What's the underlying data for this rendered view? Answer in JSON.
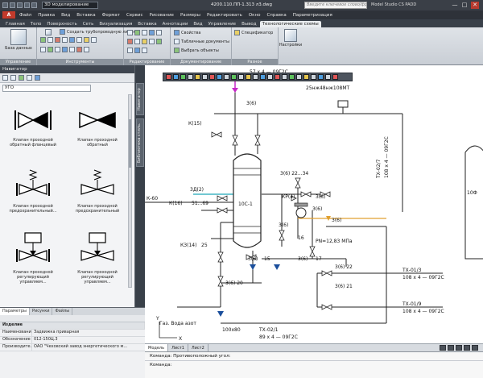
{
  "titlebar": {
    "workspace": "3D моделирование",
    "doc_title": "4200.110.ПП-1.313 л3.dwg",
    "search_placeholder": "Введите ключевое слово/фразу",
    "app_name": "Model Studio CS PADD",
    "min_glyph": "—",
    "max_glyph": "□",
    "close_glyph": "✕"
  },
  "menubar": {
    "app_button": "A",
    "items": [
      "Файл",
      "Правка",
      "Вид",
      "Вставка",
      "Формат",
      "Сервис",
      "Рисование",
      "Размеры",
      "Редактировать",
      "Окно",
      "Справка",
      "Параметризация"
    ]
  },
  "ribbon_tabs": [
    "Главная",
    "Тело",
    "Поверхность",
    "Сеть",
    "Визуализация",
    "Вставка",
    "Аннотации",
    "Вид",
    "Управление",
    "Вывод",
    "Технологические схемы"
  ],
  "ribbon_active_tab": "Технологические схемы",
  "ribbon": {
    "manage_title": "Управление",
    "database_label": "База данных",
    "tools_title": "Инструменты",
    "tools_row1": "Создать трубопроводную линию",
    "edit_title": "Редактирование",
    "docs_title": "Документирование",
    "docs_items": [
      "Свойства",
      "Табличные документы",
      "Выбрать объекты"
    ],
    "spec_label": "Спецификатор",
    "misc_title": "Разное",
    "settings_label": "Настройки"
  },
  "nav": {
    "header": "Навигатор",
    "search_value": "УГО",
    "items": [
      {
        "label": "Клапан проходной обратный фланцевый"
      },
      {
        "label": "Клапан проходной обратный"
      },
      {
        "label": "Клапан проходной предохранительный..."
      },
      {
        "label": "Клапан проходной предохранительный"
      },
      {
        "label": "Клапан проходной регулирующий управляем..."
      },
      {
        "label": "Клапан проходной регулирующий управляем..."
      }
    ]
  },
  "vtabs": [
    "Навигатор",
    "Библиотека стиль."
  ],
  "props": {
    "tabs": [
      "Параметры",
      "Рисунки",
      "Файлы"
    ],
    "group": "Изделие",
    "rows": [
      {
        "key": "Наименование",
        "value": "Задвижка приварная"
      },
      {
        "key": "Обозначение",
        "value": "012-150Ц.3"
      },
      {
        "key": "Производите...",
        "value": "ОАО \"Чеховский завод энергетического м..."
      }
    ]
  },
  "drawing": {
    "labels": [
      {
        "text": "57 х 4 — 09Г2С"
      },
      {
        "text": "25нж48нж108МТ"
      },
      {
        "text": "К(15)"
      },
      {
        "text": "3(6)"
      },
      {
        "text": "3Д(2)"
      },
      {
        "text": "К(16)"
      },
      {
        "text": "51...69"
      },
      {
        "text": "3(6) 22...34"
      },
      {
        "text": "КР(4)"
      },
      {
        "text": "3(6)"
      },
      {
        "text": "3(6)"
      },
      {
        "text": "10С-1"
      },
      {
        "text": "3(6)"
      },
      {
        "text": "PN=12,83 МПа"
      },
      {
        "text": "КЗ(14)"
      },
      {
        "text": "25"
      },
      {
        "text": "16"
      },
      {
        "text": "3(6)"
      },
      {
        "text": "3(6)"
      },
      {
        "text": "15"
      },
      {
        "text": "3(6)"
      },
      {
        "text": "17"
      },
      {
        "text": "3(6) 22"
      },
      {
        "text": "3(6) 20"
      },
      {
        "text": "3(6) 21"
      },
      {
        "text": "ТХ-01/3"
      },
      {
        "text": "108 х 4 — 09Г2С"
      },
      {
        "text": "ТХ-01/9"
      },
      {
        "text": "108 х 4 — 09Г2С"
      },
      {
        "text": "Газ. Вода  азот"
      },
      {
        "text": "100х80"
      },
      {
        "text": "ТХ-02/1"
      },
      {
        "text": "89 х 4 — 09Г2С"
      },
      {
        "text": "ТХ-02/7"
      },
      {
        "text": "108 х 4 — 09Г2С"
      },
      {
        "text": "10Ф"
      },
      {
        "text": "К-60"
      },
      {
        "text": "Y"
      },
      {
        "text": "X"
      }
    ]
  },
  "layout_tabs": [
    "Модель",
    "Лист1",
    "Лист2"
  ],
  "cmd": {
    "line1": "Команда: Противоположный угол:",
    "prompt": "Команда:"
  }
}
